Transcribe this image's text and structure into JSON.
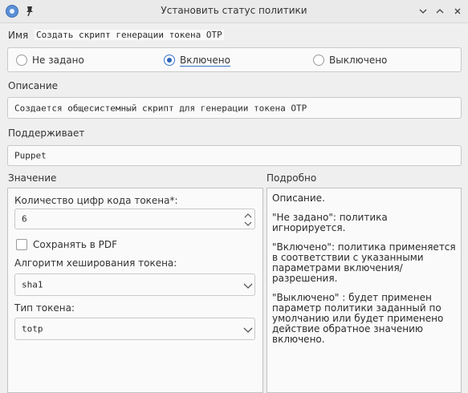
{
  "window": {
    "title": "Установить статус политики",
    "icons": {
      "app": "app-logo-icon",
      "pin": "pin-icon"
    }
  },
  "name_row": {
    "label": "Имя",
    "value": "Создать скрипт генерации токена OTP"
  },
  "state": {
    "options": [
      {
        "label": "Не задано",
        "checked": false
      },
      {
        "label": "Включено",
        "checked": true
      },
      {
        "label": "Выключено",
        "checked": false
      }
    ]
  },
  "description": {
    "label": "Описание",
    "value": "Создается общесистемный скрипт для генерации токена OTP"
  },
  "supported": {
    "label": "Поддерживает",
    "value": "Puppet"
  },
  "value_section": {
    "label": "Значение",
    "digits": {
      "label": "Количество цифр кода токена*:",
      "value": "6"
    },
    "save_pdf": {
      "label": "Сохранять в PDF",
      "checked": false
    },
    "hash": {
      "label": "Алгоритм хеширования токена:",
      "value": "sha1"
    },
    "token_type": {
      "label": "Тип токена:",
      "value": "totp"
    }
  },
  "details": {
    "label": "Подробно",
    "paragraphs": [
      "Описание.",
      "\"Не задано\": политика игнорируется.",
      "\"Включено\": политика применяется в соответствии с указанными параметрами включения/ разрешения.",
      "\"Выключено\" : будет применен параметр политики заданный по умолчанию или будет применено действие обратное значению включено."
    ]
  },
  "colors": {
    "accent": "#2d64b9",
    "background": "#efefef",
    "field": "#fafafa"
  }
}
